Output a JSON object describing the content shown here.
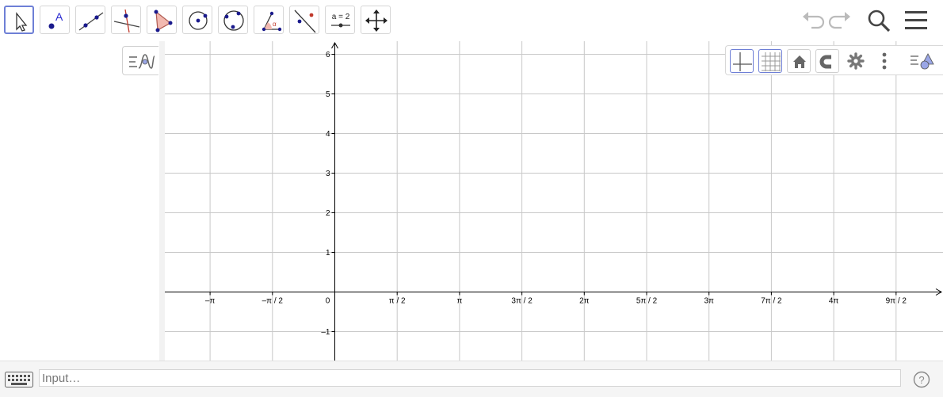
{
  "toolbar": {
    "tools": [
      "move",
      "point",
      "line",
      "perpendicular-line",
      "polygon",
      "circle-center-point",
      "circle-three-points",
      "angle",
      "reflect",
      "slider",
      "move-graphics-view"
    ],
    "selected": "move",
    "slider_label": "a = 2"
  },
  "graphics": {
    "x_ticks": [
      "–π",
      "–π / 2",
      "0",
      "π / 2",
      "π",
      "3π / 2",
      "2π",
      "5π / 2",
      "3π",
      "7π / 2",
      "4π",
      "9π / 2"
    ],
    "y_ticks": [
      "6",
      "5",
      "4",
      "3",
      "2",
      "1",
      "–1"
    ],
    "axes": true,
    "grid": true
  },
  "input_bar": {
    "placeholder": "Input…"
  },
  "colors": {
    "selected_border": "#6e7fd6",
    "point": "#1a1a8c",
    "grid": "#c8c8c8",
    "axis": "#000000"
  }
}
